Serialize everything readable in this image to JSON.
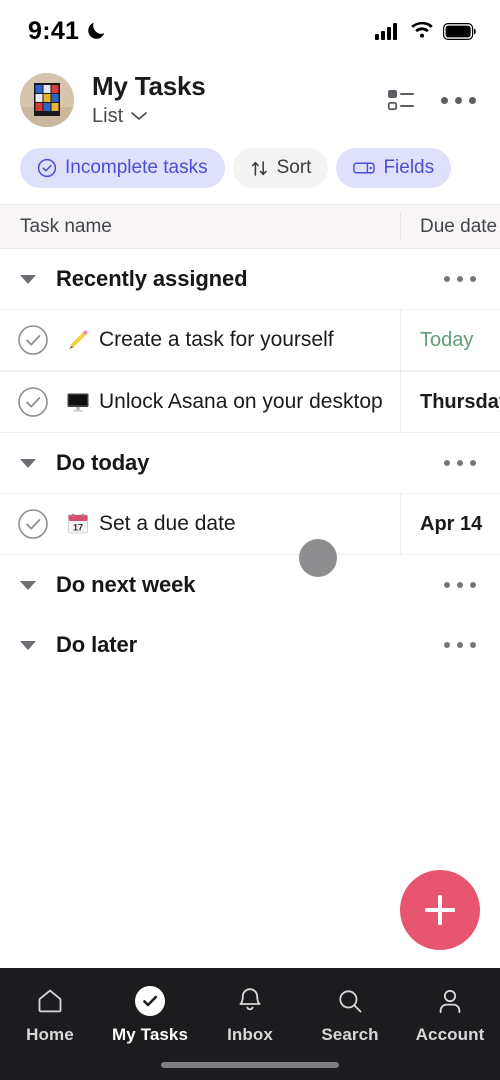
{
  "status_bar": {
    "time": "9:41",
    "dnd_icon": "moon-icon",
    "signal_icon": "cellular-signal-icon",
    "wifi_icon": "wifi-icon",
    "battery_icon": "battery-icon"
  },
  "header": {
    "avatar_name": "user-avatar",
    "title": "My Tasks",
    "view_label": "List",
    "view_chevron_icon": "chevron-down-icon",
    "list_view_icon": "list-view-icon",
    "overflow_icon": "more-options-icon"
  },
  "filters": {
    "chips": [
      {
        "label": "Incomplete tasks",
        "icon": "check-circle-icon",
        "style": "accent"
      },
      {
        "label": "Sort",
        "icon": "sort-arrows-icon",
        "style": "neutral"
      },
      {
        "label": "Fields",
        "icon": "fields-icon",
        "style": "accent"
      }
    ]
  },
  "columns": {
    "task_name": "Task name",
    "due_date": "Due date"
  },
  "sections": [
    {
      "title": "Recently assigned",
      "menu_icon": "section-more-icon",
      "collapse_icon": "collapse-triangle-icon",
      "tasks": [
        {
          "emoji": "pencil",
          "name": "Create a task for yourself",
          "due": "Today",
          "due_style": "today"
        },
        {
          "emoji": "desktop-computer",
          "name": "Unlock Asana on your desktop",
          "due": "Thursday",
          "due_style": "plain"
        }
      ]
    },
    {
      "title": "Do today",
      "menu_icon": "section-more-icon",
      "collapse_icon": "collapse-triangle-icon",
      "tasks": [
        {
          "emoji": "calendar",
          "name": "Set a due date",
          "due": "Apr 14",
          "due_style": "plain"
        }
      ]
    },
    {
      "title": "Do next week",
      "menu_icon": "section-more-icon",
      "collapse_icon": "collapse-triangle-icon",
      "tasks": []
    },
    {
      "title": "Do later",
      "menu_icon": "section-more-icon",
      "collapse_icon": "collapse-triangle-icon",
      "tasks": []
    }
  ],
  "fab": {
    "icon": "plus-icon",
    "color": "#e8556e"
  },
  "cursor": {
    "name": "touch-cursor",
    "color": "#8d8d8f"
  },
  "bottom_nav": {
    "items": [
      {
        "label": "Home",
        "icon": "home-icon",
        "active": false
      },
      {
        "label": "My Tasks",
        "icon": "check-circle-filled-icon",
        "active": true
      },
      {
        "label": "Inbox",
        "icon": "bell-icon",
        "active": false
      },
      {
        "label": "Search",
        "icon": "search-icon",
        "active": false
      },
      {
        "label": "Account",
        "icon": "person-icon",
        "active": false
      }
    ],
    "home_indicator": "home-indicator"
  },
  "colors": {
    "accent_chip_bg": "#dfe0fb",
    "accent_chip_text": "#4a4fd0",
    "due_today_green": "#5f9e79",
    "fab_pink": "#e8556e",
    "nav_bg": "#1c1c1e"
  }
}
